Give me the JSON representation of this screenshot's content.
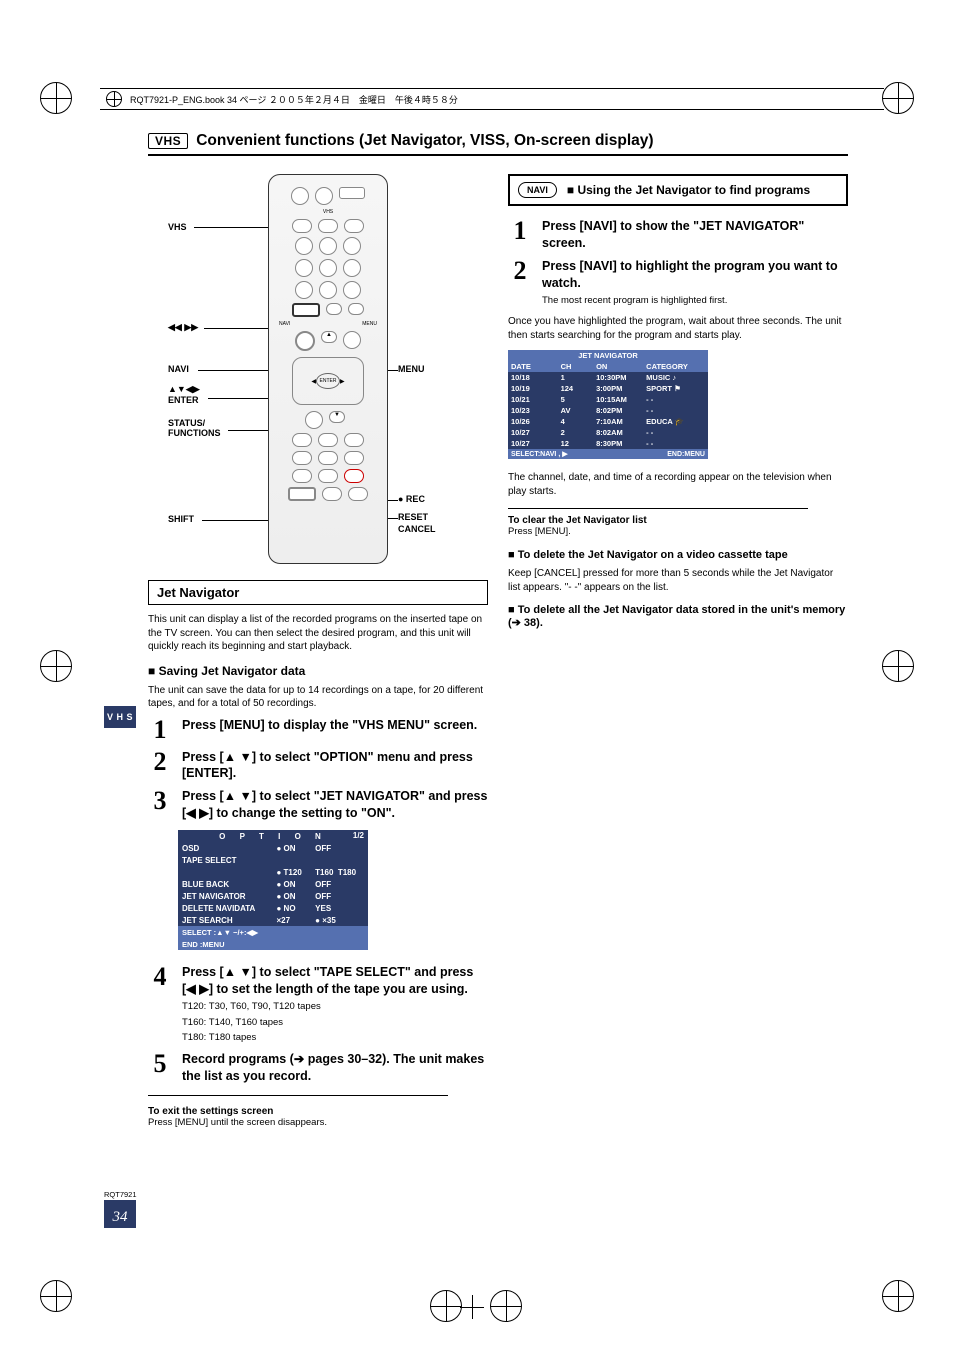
{
  "meta": {
    "header_line": "RQT7921-P_ENG.book  34 ページ  ２００５年２月４日　金曜日　午後４時５８分",
    "rqt": "RQT7921",
    "page_number": "34"
  },
  "title": {
    "tag": "VHS",
    "text": "Convenient functions (Jet Navigator, VISS, On-screen display)"
  },
  "remote_labels": {
    "vhs": "VHS",
    "skip": "◀◀ ▶▶",
    "navi": "NAVI",
    "arrows_enter": "▲▼◀▶\nENTER",
    "status_functions": "STATUS/\nFUNCTIONS",
    "shift": "SHIFT",
    "menu": "MENU",
    "rec": "● REC",
    "reset": "RESET",
    "cancel": "CANCEL"
  },
  "side_tab": "V H S",
  "left": {
    "section_title": "Jet Navigator",
    "intro": "This unit can display a list of the recorded programs on the inserted tape on the TV screen. You can then select the desired program, and this unit will quickly reach its beginning and start playback.",
    "saving_head": "Saving Jet Navigator data",
    "saving_text": "The unit can save the data for up to 14 recordings on a tape, for 20 different tapes, and for a total of 50 recordings.",
    "steps": {
      "s1": "Press [MENU] to display the \"VHS MENU\" screen.",
      "s2": "Press [▲ ▼] to select \"OPTION\" menu and press [ENTER].",
      "s3": "Press [▲ ▼] to select \"JET NAVIGATOR\" and press [◀ ▶] to change the setting to \"ON\".",
      "s4": "Press [▲ ▼] to select \"TAPE SELECT\" and press [◀ ▶] to set the length of the tape you are using.",
      "s4_sub_1": "T120:  T30, T60, T90, T120 tapes",
      "s4_sub_2": "T160:  T140, T160 tapes",
      "s4_sub_3": "T180:  T180 tapes",
      "s5": "Record programs (➔ pages 30–32). The unit makes the list as you record."
    },
    "option_table": {
      "title": "O P T I O N",
      "page_ind": "1/2",
      "rows": [
        [
          "OSD",
          "● ON",
          "OFF"
        ],
        [
          "TAPE SELECT",
          "",
          ""
        ],
        [
          "",
          "● T120",
          "T160",
          "T180"
        ],
        [
          "BLUE BACK",
          "● ON",
          "OFF"
        ],
        [
          "JET NAVIGATOR",
          "● ON",
          "OFF"
        ],
        [
          "DELETE NAVIDATA",
          "● NO",
          "YES"
        ],
        [
          "JET SEARCH",
          "×27",
          "● ×35"
        ]
      ],
      "footer_select": "SELECT :▲▼ −/+:◀▶",
      "footer_end": "END       :MENU"
    },
    "exit_label": "To exit the settings screen",
    "exit_text": "Press [MENU] until the screen disappears."
  },
  "right": {
    "navi_pill": "NAVI",
    "head": "Using the Jet Navigator to find programs",
    "step1": "Press [NAVI] to show the \"JET NAVIGATOR\" screen.",
    "step2": "Press [NAVI] to highlight the program you want to watch.",
    "step2_sub": "The most recent program is highlighted first.",
    "after_steps": "Once you have highlighted the program, wait about three seconds. The unit then starts searching for the program and starts play.",
    "navi_table": {
      "title": "JET NAVIGATOR",
      "cols": [
        "DATE",
        "CH",
        "ON",
        "CATEGORY"
      ],
      "rows": [
        [
          "10/18",
          "1",
          "10:30PM",
          "MUSIC ♪"
        ],
        [
          "10/19",
          "124",
          "3:00PM",
          "SPORT ⚑"
        ],
        [
          "10/21",
          "5",
          "10:15AM",
          "- -"
        ],
        [
          "10/23",
          "AV",
          "8:02PM",
          "- -"
        ],
        [
          "10/26",
          "4",
          "7:10AM",
          "EDUCA 🎓"
        ],
        [
          "10/27",
          "2",
          "8:02AM",
          "- -"
        ],
        [
          "10/27",
          "12",
          "8:30PM",
          "- -"
        ]
      ],
      "footer_l": "SELECT:NAVI , ▶",
      "footer_r": "END:MENU"
    },
    "after_table": "The channel, date, and time of a recording appear on the television when play starts.",
    "clear_head": "To clear the Jet Navigator list",
    "clear_text": "Press [MENU].",
    "delete_tape_head": "To delete the Jet Navigator on a video cassette tape",
    "delete_tape_text": "Keep [CANCEL] pressed for more than 5 seconds while the Jet Navigator list appears. \"- -\" appears on the list.",
    "delete_all_head": "To delete all the Jet Navigator data stored in the unit's memory (➔ 38)."
  }
}
